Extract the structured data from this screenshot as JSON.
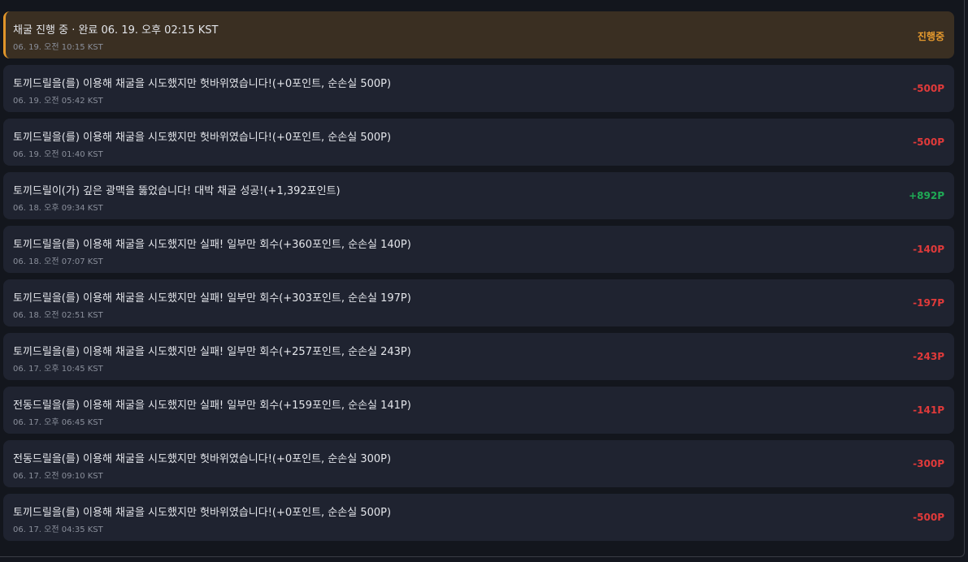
{
  "colors": {
    "negative": "#e03a3a",
    "positive": "#1faa55",
    "in_progress": "#e69a2e"
  },
  "entries": [
    {
      "message": "채굴 진행 중 · 완료 06. 19. 오후 02:15 KST",
      "time": "06. 19. 오전 10:15 KST",
      "amount": "진행중",
      "status": "in_progress"
    },
    {
      "message": "토끼드릴을(를) 이용해 채굴을 시도했지만 헛바위였습니다!(+0포인트, 순손실 500P)",
      "time": "06. 19. 오전 05:42 KST",
      "amount": "-500P",
      "status": "negative"
    },
    {
      "message": "토끼드릴을(를) 이용해 채굴을 시도했지만 헛바위였습니다!(+0포인트, 순손실 500P)",
      "time": "06. 19. 오전 01:40 KST",
      "amount": "-500P",
      "status": "negative"
    },
    {
      "message": "토끼드릴이(가) 깊은 광맥을 뚫었습니다! 대박 채굴 성공!(+1,392포인트)",
      "time": "06. 18. 오후 09:34 KST",
      "amount": "+892P",
      "status": "positive"
    },
    {
      "message": "토끼드릴을(를) 이용해 채굴을 시도했지만 실패! 일부만 회수(+360포인트, 순손실 140P)",
      "time": "06. 18. 오전 07:07 KST",
      "amount": "-140P",
      "status": "negative"
    },
    {
      "message": "토끼드릴을(를) 이용해 채굴을 시도했지만 실패! 일부만 회수(+303포인트, 순손실 197P)",
      "time": "06. 18. 오전 02:51 KST",
      "amount": "-197P",
      "status": "negative"
    },
    {
      "message": "토끼드릴을(를) 이용해 채굴을 시도했지만 실패! 일부만 회수(+257포인트, 순손실 243P)",
      "time": "06. 17. 오후 10:45 KST",
      "amount": "-243P",
      "status": "negative"
    },
    {
      "message": "전동드릴을(를) 이용해 채굴을 시도했지만 실패! 일부만 회수(+159포인트, 순손실 141P)",
      "time": "06. 17. 오후 06:45 KST",
      "amount": "-141P",
      "status": "negative"
    },
    {
      "message": "전동드릴을(를) 이용해 채굴을 시도했지만 헛바위였습니다!(+0포인트, 순손실 300P)",
      "time": "06. 17. 오전 09:10 KST",
      "amount": "-300P",
      "status": "negative"
    },
    {
      "message": "토끼드릴을(를) 이용해 채굴을 시도했지만 헛바위였습니다!(+0포인트, 순손실 500P)",
      "time": "06. 17. 오전 04:35 KST",
      "amount": "-500P",
      "status": "negative"
    }
  ]
}
